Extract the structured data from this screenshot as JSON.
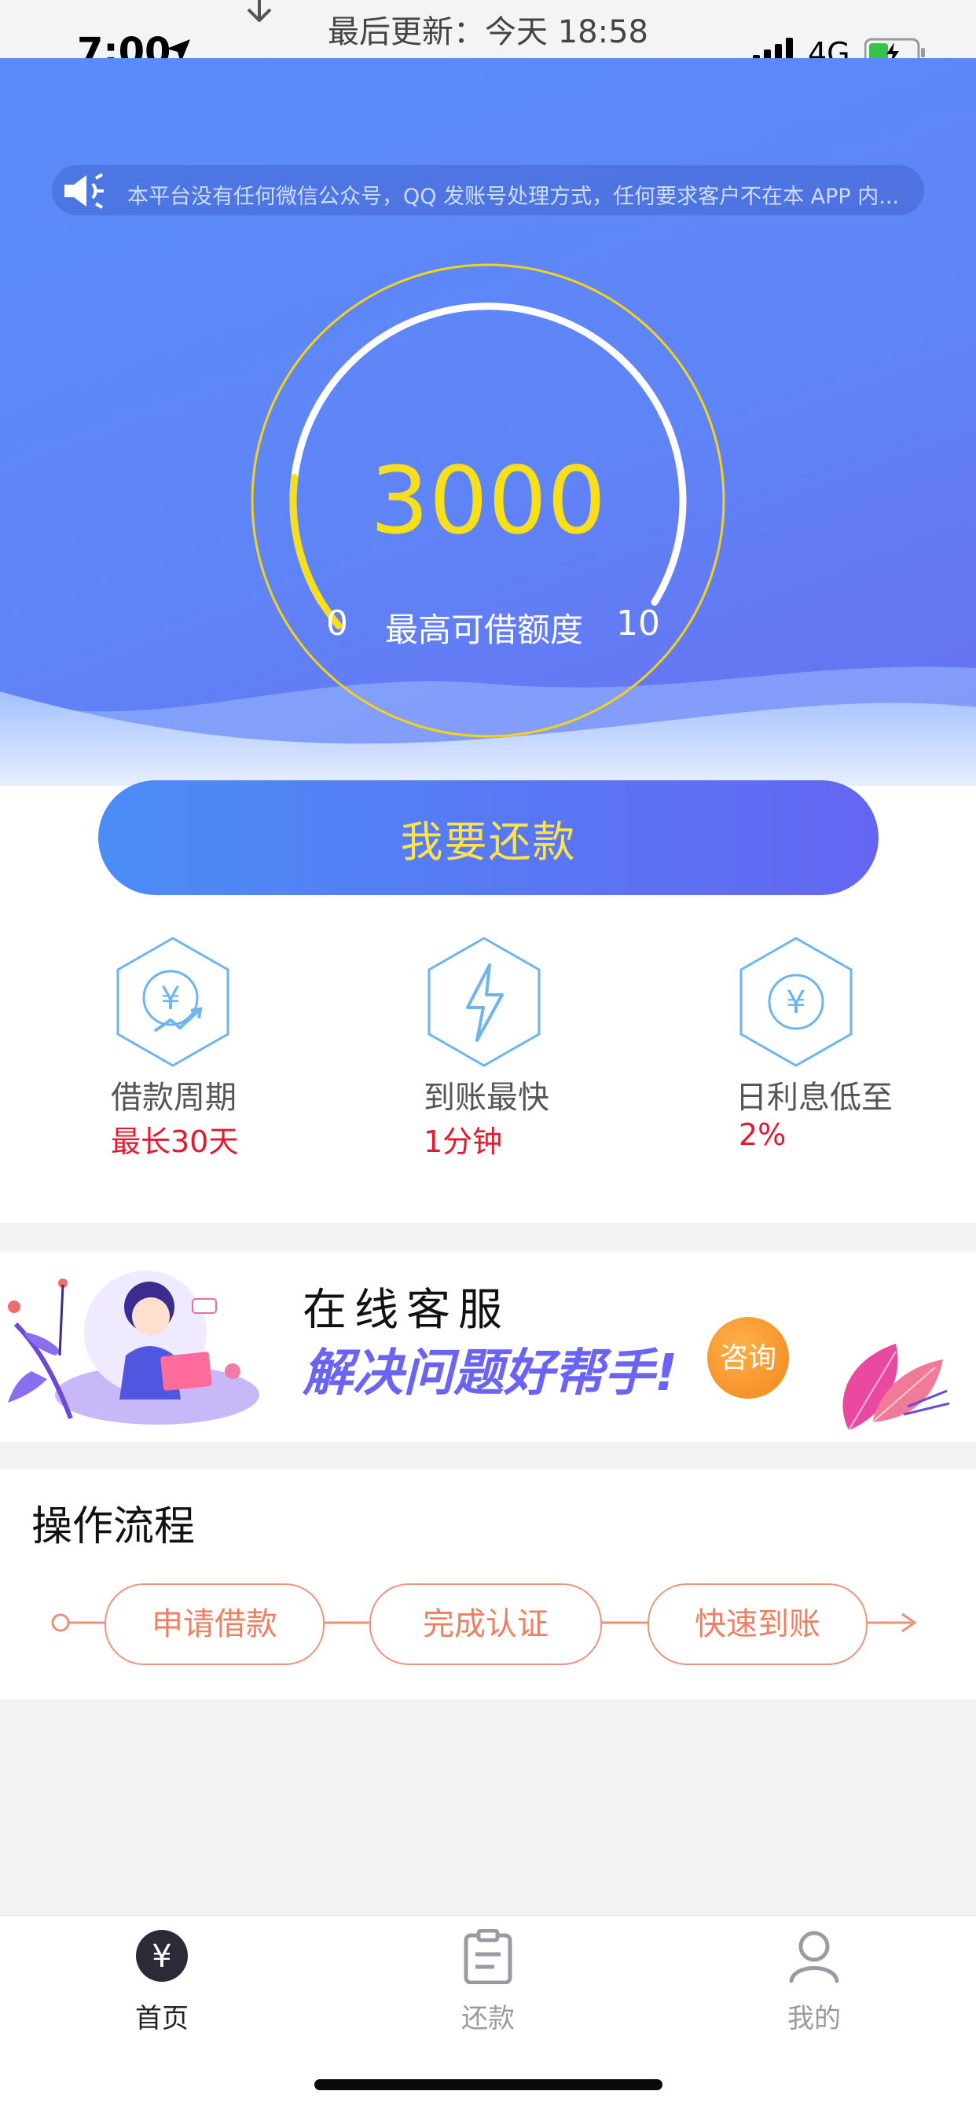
{
  "status_bar": {
    "time": "7:00",
    "network": "4G",
    "refresh_text": "最后更新：今天 18:58"
  },
  "notice": {
    "icon": "speaker-icon",
    "text": "本平台没有任何微信公众号，QQ 发账号处理方式，任何要求客户不在本 APP 内..."
  },
  "credit": {
    "amount": "3000",
    "min_label": "0",
    "max_label": "10",
    "limit_label": "最高可借额度",
    "gauge_fill_fraction": 0.18,
    "gauge_color": "#f9df1a"
  },
  "repay_button": {
    "label": "我要还款"
  },
  "features": [
    {
      "icon": "yuan-chart-icon",
      "title": "借款周期",
      "value": "最长30天"
    },
    {
      "icon": "lightning-icon",
      "title": "到账最快",
      "value": "1分钟"
    },
    {
      "icon": "yuan-coin-icon",
      "title": "日利息低至",
      "value": "2%"
    }
  ],
  "banner": {
    "title": "在线客服",
    "subtitle": "解决问题好帮手!",
    "consult_label": "咨询"
  },
  "process": {
    "title": "操作流程",
    "steps": [
      "申请借款",
      "完成认证",
      "快速到账"
    ]
  },
  "tabbar": {
    "items": [
      {
        "label": "首页",
        "icon": "yuan-home-icon",
        "active": true
      },
      {
        "label": "还款",
        "icon": "clipboard-icon",
        "active": false
      },
      {
        "label": "我的",
        "icon": "user-icon",
        "active": false
      }
    ]
  },
  "colors": {
    "accent_blue": "#5a8cf9",
    "accent_purple": "#6466f2",
    "highlight_yellow": "#f9df1a",
    "value_red": "#e3192e",
    "step_orange": "#ef7f62"
  }
}
